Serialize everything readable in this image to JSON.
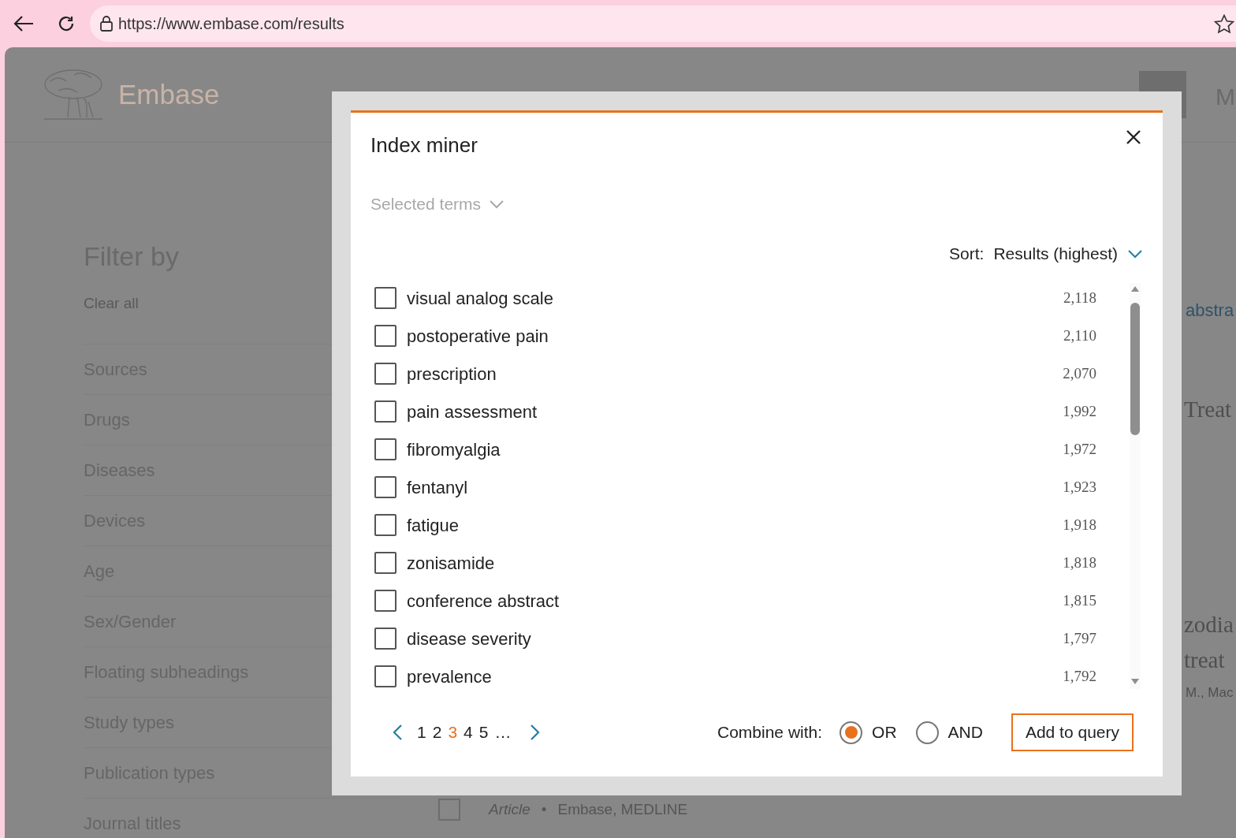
{
  "browser": {
    "url": "https://www.embase.com/results"
  },
  "header": {
    "brand": "Embase",
    "account_initial": "M"
  },
  "filter": {
    "title": "Filter by",
    "clear": "Clear all",
    "items": [
      "Sources",
      "Drugs",
      "Diseases",
      "Devices",
      "Age",
      "Sex/Gender",
      "Floating subheadings",
      "Study types",
      "Publication types",
      "Journal titles"
    ]
  },
  "results": {
    "fragments": [
      {
        "kind": "link",
        "text": "abstra"
      },
      {
        "kind": "title",
        "text": "Treat"
      },
      {
        "kind": "title",
        "text": "zodia"
      },
      {
        "kind": "title",
        "text": "treat"
      },
      {
        "kind": "authors",
        "text": "M., Mac"
      }
    ],
    "article": {
      "checked": false,
      "type": "Article",
      "separator": "•",
      "sources": "Embase, MEDLINE"
    }
  },
  "modal": {
    "title": "Index miner",
    "selected_terms": "Selected terms",
    "sort_label": "Sort:",
    "sort_value": "Results (highest)",
    "terms": [
      {
        "label": "visual analog scale",
        "count": "2,118",
        "checked": false
      },
      {
        "label": "postoperative pain",
        "count": "2,110",
        "checked": false
      },
      {
        "label": "prescription",
        "count": "2,070",
        "checked": false
      },
      {
        "label": "pain assessment",
        "count": "1,992",
        "checked": false
      },
      {
        "label": "fibromyalgia",
        "count": "1,972",
        "checked": false
      },
      {
        "label": "fentanyl",
        "count": "1,923",
        "checked": false
      },
      {
        "label": "fatigue",
        "count": "1,918",
        "checked": false
      },
      {
        "label": "zonisamide",
        "count": "1,818",
        "checked": false
      },
      {
        "label": "conference abstract",
        "count": "1,815",
        "checked": false
      },
      {
        "label": "disease severity",
        "count": "1,797",
        "checked": false
      },
      {
        "label": "prevalence",
        "count": "1,792",
        "checked": false
      }
    ],
    "pages": [
      {
        "label": "1",
        "selected": false
      },
      {
        "label": "2",
        "selected": false
      },
      {
        "label": "3",
        "selected": true
      },
      {
        "label": "4",
        "selected": false
      },
      {
        "label": "5",
        "selected": false
      },
      {
        "label": "…",
        "selected": false
      }
    ],
    "combine_label": "Combine with:",
    "combine_options": [
      {
        "label": "OR",
        "selected": true
      },
      {
        "label": "AND",
        "selected": false
      }
    ],
    "add_button": "Add to query"
  }
}
